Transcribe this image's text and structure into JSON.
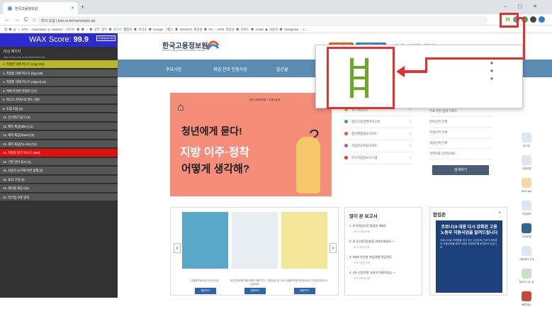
{
  "browser": {
    "tab_title": "한국고용정보원",
    "url": "주의 요함 | keis.or.kr/main/index.do",
    "bookmarks": "앱  ◉  Q  ☆  STN - Download  ◎ android - 리스트  ◉  ◉ ○ ◉ 공부 업무  ◉ 오크스 웹접속  ◉ 서식소  ◉ Google 그룹스  ◉ INSIGHT 회의실  ◉ PC - APNI 회의실  ◉ 가이드  ◉ GAMI  ◉ 사용자  ◉ Stangeline - 1 ..."
  },
  "wax": {
    "score_label": "WAX Score:",
    "score_value": "99.9",
    "close_label": "Collapse All",
    "heading": "대상 페이지",
    "url": "http://www.keis.or.kr/main/index.do",
    "items": [
      {
        "label": "1. 적절한 대체 텍스트 (img) (56)",
        "style": "hl"
      },
      {
        "label": "1. 적절한 대체 텍스트 (bg) (35)",
        "style": ""
      },
      {
        "label": "1. 적절한 대체 텍스트 (object) (4)",
        "style": ""
      },
      {
        "label": "3. 색에 무관한 콘텐츠 인식",
        "style": ""
      },
      {
        "label": "5. 텍스트 콘텐츠의 명도 대비",
        "style": ""
      },
      {
        "label": "8. 초점 이동 (0)",
        "style": ""
      },
      {
        "label": "12. 건너뛰기 링크 (0)",
        "style": ""
      },
      {
        "label": "13. 제목 제공(title>) (1)",
        "style": ""
      },
      {
        "label": "13. 제목 제공(frame) (0)",
        "style": ""
      },
      {
        "label": "13. 제목 제공(h1~h6) (31)",
        "style": ""
      },
      {
        "label": "14. 적절한 링크 텍스트 (468)",
        "style": "red"
      },
      {
        "label": "15. 기본 언어 표시 (1)",
        "style": ""
      },
      {
        "label": "16. 사용자 요구에 따른 실행 (0)",
        "style": ""
      },
      {
        "label": "18. 표의 구성 (0)",
        "style": ""
      },
      {
        "label": "19. 레이블 제공 (20)",
        "style": ""
      },
      {
        "label": "21. 마크업 오류 방지",
        "style": ""
      }
    ]
  },
  "site": {
    "logo": "한국고용정보원",
    "logo_sub": "Korea Employment Information Service",
    "top_links": [
      "고용정보포털",
      "국민참여정보공개",
      "HRD정보화",
      "사이트맵",
      "웹접근성",
      "ENGLISH"
    ],
    "gnb": [
      "주요사업",
      "취업·진로 인정사업",
      "발간물"
    ],
    "banner": {
      "tag": "한국고용정보원 × 고용노동부",
      "line1": "청년에게 묻다!",
      "line2": "지방 이주·정착",
      "line3": "어떻게 생각해?"
    },
    "services": [
      "워크넷(청년)",
      "청년고용정책마이스터",
      "청년취업정보사이트",
      "직업진로포털사이트",
      "한국직업정보시스템"
    ],
    "search_rows": [
      "주요 추천 검색 키워드",
      "분류선택  전체",
      "주제선택  전체",
      "대상선택  전체",
      "검색어를 입력하세요"
    ],
    "search_button": "검색하기",
    "quick": [
      "워크넷",
      "고용보험",
      "HRD-Net",
      "직업정보",
      "사이트맵",
      "고용센터 소개",
      "찾아오시는 길",
      "빠른메뉴"
    ],
    "books": [
      "고용정보센터의 2021년 6호",
      "국민건강보험 재정지원과 적용 연구 - 기록근로 및 임금체계",
      "2019 대졸자직업이동경로조사 기초분석보고서"
    ],
    "book_button": "원문보기",
    "reports_title": "많이 본 보고서",
    "reports": [
      {
        "t": "1. 한국직업사전 통합본 제5판",
        "s": "한국고용정보원"
      },
      {
        "t": "2. 한국고용직업분류 2018 해설서 ~",
        "s": "한국고용정보원"
      },
      {
        "t": "3. 2020 청년층 취업경험 직업전망",
        "s": "한국고용정보원"
      },
      {
        "t": "4. 4차 산업혁명 시대의 미래직업능 ~",
        "s": "한국고용정보원"
      }
    ],
    "popup_title": "팝업존",
    "popup_head": "코로나19 대응 다시 강화된 고용노동부 지원사업을 알려드립니다",
    "popup_sub": "코로나19로 어려움을 겪고 있는 사업주와 근로자 여러분의 고용안정을 위해 다양한 지원제도를 운영하고 있습니다."
  },
  "colors": {
    "accent_red": "#e53030",
    "wax_blue": "#2b2bd0",
    "ladder_green": "#6aaa2a"
  }
}
